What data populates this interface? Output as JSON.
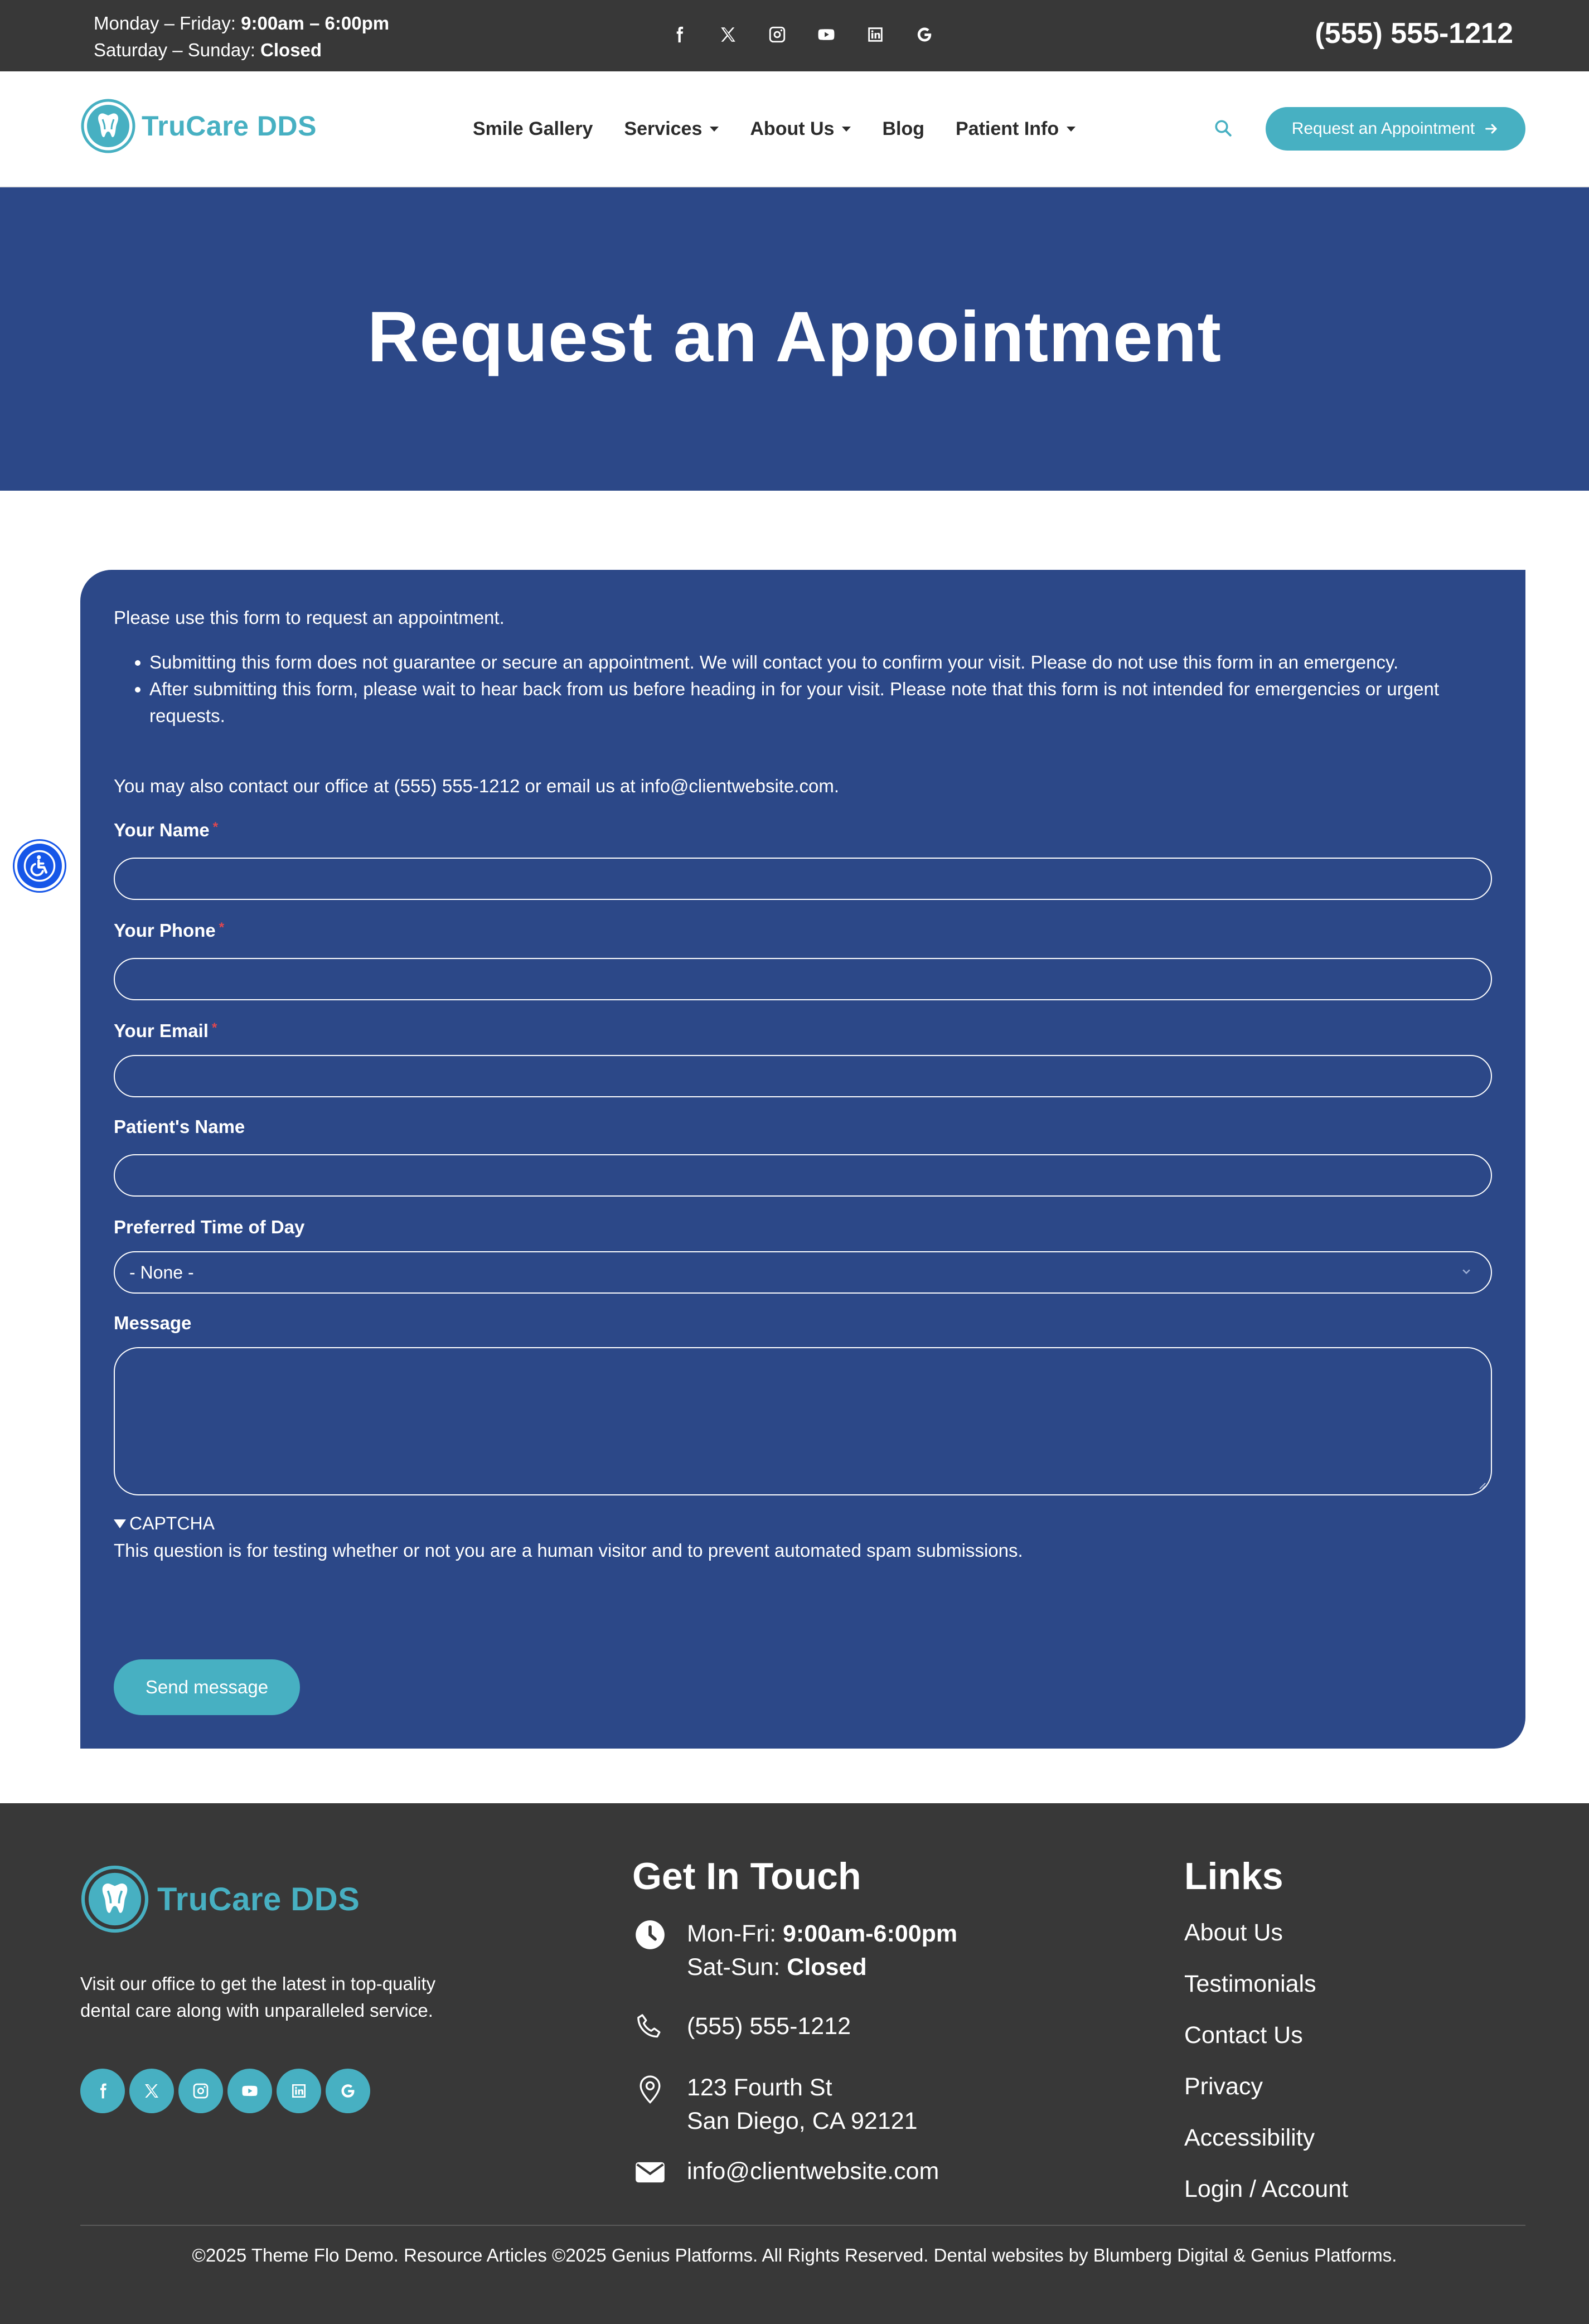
{
  "colors": {
    "topbar_bg": "#383838",
    "primary_blue": "#2c4888",
    "accent_teal": "#47b0c2",
    "footer_bg": "#383838",
    "required_star": "#e0474f",
    "a11y_blue": "#1656e8"
  },
  "topbar": {
    "weekday_label": "Monday – Friday:",
    "weekday_hours": "9:00am – 6:00pm",
    "weekend_label": "Saturday – Sunday:",
    "weekend_hours": "Closed",
    "phone": "(555) 555-1212",
    "social_icons": [
      "facebook-icon",
      "x-icon",
      "instagram-icon",
      "youtube-icon",
      "linkedin-icon",
      "google-icon"
    ]
  },
  "header": {
    "logo_text": "TruCare DDS",
    "nav": [
      {
        "label": "Smile Gallery",
        "dropdown": false
      },
      {
        "label": "Services",
        "dropdown": true
      },
      {
        "label": "About Us",
        "dropdown": true
      },
      {
        "label": "Blog",
        "dropdown": false
      },
      {
        "label": "Patient Info",
        "dropdown": true
      }
    ],
    "search_icon": "search-icon",
    "cta_label": "Request an Appointment",
    "cta_icon": "arrow-right-icon"
  },
  "hero": {
    "title": "Request an Appointment"
  },
  "form": {
    "intro": "Please use this form to request an appointment.",
    "bullets": [
      "Submitting this form does not guarantee or secure an appointment. We will contact you to confirm your visit. Please do not use this form in an emergency.",
      "After submitting this form, please wait to hear back from us before heading in for your visit. Please note that this form is not intended for emergencies or urgent requests."
    ],
    "contact_line": "You may also contact our office at (555) 555-1212 or email us at info@clientwebsite.com.",
    "fields": {
      "name": {
        "label": "Your Name",
        "required_mark": "*",
        "value": ""
      },
      "phone": {
        "label": "Your Phone",
        "required_mark": "*",
        "value": ""
      },
      "email": {
        "label": "Your Email",
        "required_mark": "*",
        "value": ""
      },
      "patient": {
        "label": "Patient's Name",
        "value": ""
      },
      "time": {
        "label": "Preferred Time of Day",
        "selected": "- None -"
      },
      "message": {
        "label": "Message",
        "value": ""
      }
    },
    "captcha_title": "CAPTCHA",
    "captcha_desc": "This question is for testing whether or not you are a human visitor and to prevent automated spam submissions.",
    "submit_label": "Send message"
  },
  "footer": {
    "logo_text": "TruCare DDS",
    "about": "Visit our office to get the latest in top-quality dental care along with unparalleled service.",
    "social_icons": [
      "facebook-icon",
      "x-icon",
      "instagram-icon",
      "youtube-icon",
      "linkedin-icon",
      "google-icon"
    ],
    "contact_heading": "Get In Touch",
    "hours_weekday_label": "Mon-Fri:",
    "hours_weekday": "9:00am-6:00pm",
    "hours_weekend_label": "Sat-Sun:",
    "hours_weekend": "Closed",
    "phone": "(555) 555-1212",
    "address_line1": "123 Fourth St",
    "address_line2": "San Diego, CA 92121",
    "email": "info@clientwebsite.com",
    "links_heading": "Links",
    "links": [
      "About Us",
      "Testimonials",
      "Contact Us",
      "Privacy",
      "Accessibility",
      "Login / Account"
    ],
    "copyright": "©2025 Theme Flo Demo. Resource Articles ©2025 Genius Platforms. All Rights Reserved. Dental websites by Blumberg Digital & Genius Platforms."
  }
}
